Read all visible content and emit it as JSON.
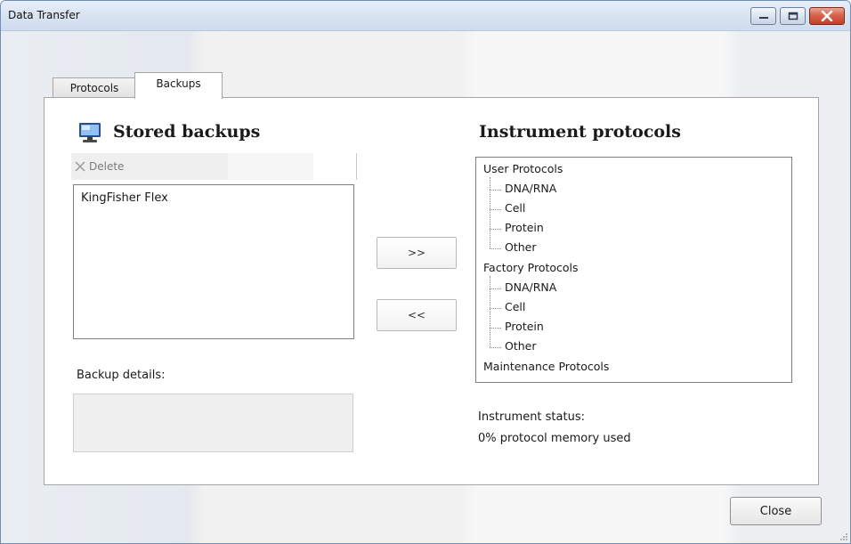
{
  "window": {
    "title": "Data Transfer"
  },
  "tabs": [
    {
      "label": "Protocols",
      "selected": false
    },
    {
      "label": "Backups",
      "selected": true
    }
  ],
  "left_pane": {
    "title": "Stored backups",
    "toolbar": {
      "delete_label": "Delete"
    },
    "backups": [
      "KingFisher Flex"
    ],
    "details_label": "Backup details:"
  },
  "transfer": {
    "to_instrument_label": ">>",
    "to_backups_label": "<<"
  },
  "right_pane": {
    "title": "Instrument protocols",
    "tree": [
      {
        "label": "User Protocols",
        "children": [
          "DNA/RNA",
          "Cell",
          "Protein",
          "Other"
        ]
      },
      {
        "label": "Factory Protocols",
        "children": [
          "DNA/RNA",
          "Cell",
          "Protein",
          "Other"
        ]
      },
      {
        "label": "Maintenance Protocols",
        "children": []
      }
    ],
    "status_label": "Instrument status:",
    "status_value": "0% protocol memory used"
  },
  "footer": {
    "close_label": "Close"
  },
  "colors": {
    "titlebar": "#d9e4f2",
    "close_button": "#c2402a",
    "panel_border": "#a6a6a6"
  }
}
